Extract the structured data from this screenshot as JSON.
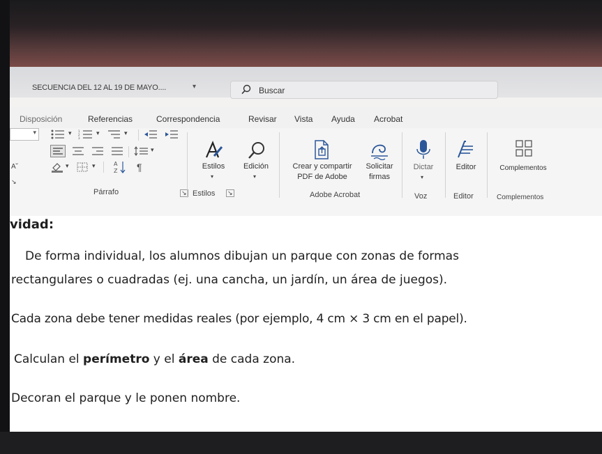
{
  "window": {
    "document_title": "SECUENCIA DEL 12 AL 19 DE MAYO....",
    "search_label": "Buscar"
  },
  "menu": [
    "Disposición",
    "Referencias",
    "Correspondencia",
    "Revisar",
    "Vista",
    "Ayuda",
    "Acrobat"
  ],
  "ribbon": {
    "paragraph_group": "Párrafo",
    "styles_button": "Estilos",
    "editing_button": "Edición",
    "styles_group": "Estilos",
    "create_share_pdf_line1": "Crear y compartir",
    "create_share_pdf_line2": "PDF de Adobe",
    "request_sign_line1": "Solicitar",
    "request_sign_line2": "firmas",
    "acrobat_group": "Adobe Acrobat",
    "dictate_button": "Dictar",
    "voice_group": "Voz",
    "editor_button": "Editor",
    "editor_group": "Editor",
    "addins_button": "Complementos",
    "addins_group": "Complementos"
  },
  "document": {
    "heading": "vidad:",
    "lines": [
      "De forma individual, los alumnos dibujan un parque con zonas de formas",
      "rectangulares o cuadradas (ej. una cancha, un jardín, un área de juegos).",
      "Cada zona debe tener medidas reales (por ejemplo, 4 cm × 3 cm en el papel).",
      "Decoran el parque y le ponen nombre."
    ],
    "line4_part1": "Calculan el ",
    "line4_bold1": "perímetro",
    "line4_part2": " y el ",
    "line4_bold2": "área",
    "line4_part3": " de cada zona."
  },
  "colors": {
    "accent": "#2b579a",
    "ribbon_bg": "#f5f5f5",
    "doc_text": "#1f1f1f"
  }
}
